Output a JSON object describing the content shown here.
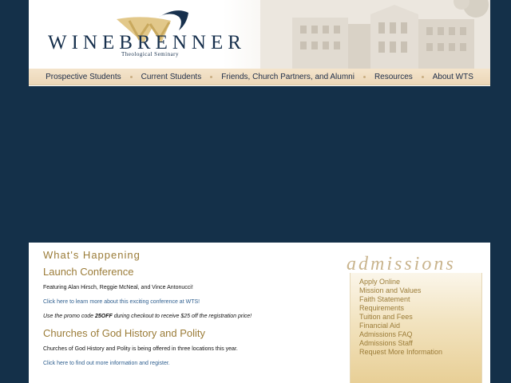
{
  "header": {
    "wordmark": "WINEBRENNER",
    "subtitle": "Theological Seminary"
  },
  "nav": {
    "items": [
      {
        "label": "Prospective Students"
      },
      {
        "label": "Current Students"
      },
      {
        "label": "Friends, Church Partners, and Alumni"
      },
      {
        "label": "Resources"
      },
      {
        "label": "About WTS"
      }
    ]
  },
  "main": {
    "section_title": "What's Happening",
    "events": [
      {
        "title": "Launch Conference",
        "text": "Featuring Alan Hirsch, Reggie McNeal, and Vince Antonucci!",
        "link": "Click here to learn more about this exciting conference at WTS!",
        "promo_before": "Use the promo code ",
        "promo_code": "25OFF",
        "promo_after": " during checkout to receive $25 off the registration price!"
      },
      {
        "title": "Churches of God History and Polity",
        "text": "Churches of God History and Polity is being offered in three locations this year.",
        "link": "Click here to find out more information and register."
      }
    ]
  },
  "admissions": {
    "heading": "admissions",
    "items": [
      "Apply Online",
      "Mission and Values",
      "Faith Statement",
      "Requirements",
      "Tuition and Fees",
      "Financial Aid",
      "Admissions FAQ",
      "Admissions Staff",
      "Request More Information"
    ]
  },
  "colors": {
    "background": "#143049",
    "accent_gold": "#9b7c38",
    "navy": "#17304d",
    "link": "#2f5f8f"
  }
}
